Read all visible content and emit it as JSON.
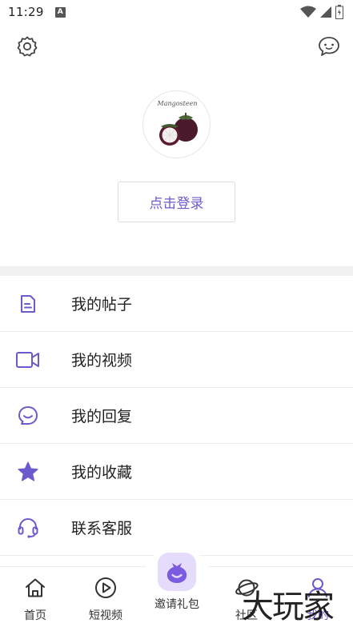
{
  "status_bar": {
    "time": "11:29",
    "badge": "A",
    "icons": [
      "wifi-icon",
      "signal-icon",
      "battery-icon"
    ]
  },
  "header": {
    "settings_icon": "gear-icon",
    "message_icon": "chat-bubble-icon"
  },
  "profile": {
    "avatar_caption": "Mangosteen",
    "login_label": "点击登录"
  },
  "menu": {
    "items": [
      {
        "label": "我的帖子",
        "icon": "document-icon"
      },
      {
        "label": "我的视频",
        "icon": "video-camera-icon"
      },
      {
        "label": "我的回复",
        "icon": "reply-bubble-icon"
      },
      {
        "label": "我的收藏",
        "icon": "star-icon"
      },
      {
        "label": "联系客服",
        "icon": "headset-icon"
      }
    ]
  },
  "bottom_nav": {
    "items": [
      {
        "label": "首页",
        "icon": "home-icon"
      },
      {
        "label": "短视频",
        "icon": "play-circle-icon"
      },
      {
        "label": "邀请礼包",
        "icon": "gift-bag-icon"
      },
      {
        "label": "社区",
        "icon": "planet-icon"
      },
      {
        "label": "我的",
        "icon": "user-icon",
        "active": true
      }
    ]
  },
  "watermark": "大玩家",
  "colors": {
    "accent": "#6a5acd",
    "accent_light": "#e5dcfb",
    "divider": "#f1f1f1"
  }
}
